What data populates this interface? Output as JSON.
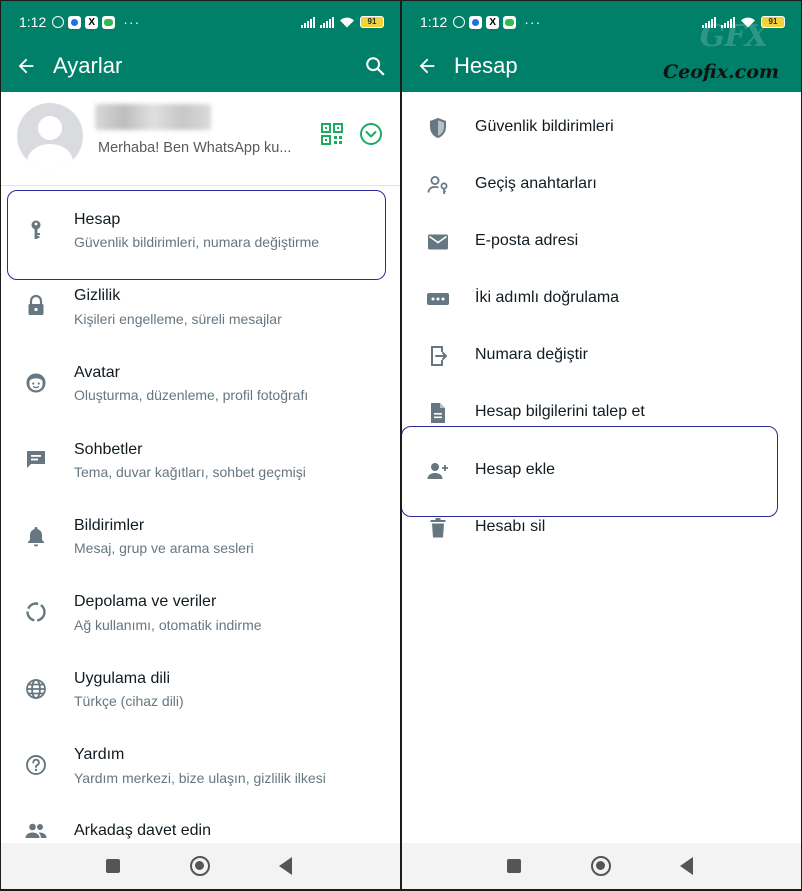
{
  "status_bar": {
    "time": "1:12",
    "battery": "91",
    "more": "···"
  },
  "left": {
    "title": "Ayarlar",
    "profile": {
      "status_text": "Merhaba! Ben WhatsApp ku..."
    },
    "items": [
      {
        "title": "Hesap",
        "subtitle": "Güvenlik bildirimleri, numara değiştirme",
        "icon": "key-icon"
      },
      {
        "title": "Gizlilik",
        "subtitle": "Kişileri engelleme, süreli mesajlar",
        "icon": "lock-icon"
      },
      {
        "title": "Avatar",
        "subtitle": "Oluşturma, düzenleme, profil fotoğrafı",
        "icon": "avatar-icon"
      },
      {
        "title": "Sohbetler",
        "subtitle": "Tema, duvar kağıtları, sohbet geçmişi",
        "icon": "chat-icon"
      },
      {
        "title": "Bildirimler",
        "subtitle": "Mesaj, grup ve arama sesleri",
        "icon": "bell-icon"
      },
      {
        "title": "Depolama ve veriler",
        "subtitle": "Ağ kullanımı, otomatik indirme",
        "icon": "storage-icon"
      },
      {
        "title": "Uygulama dili",
        "subtitle": "Türkçe (cihaz dili)",
        "icon": "globe-icon"
      },
      {
        "title": "Yardım",
        "subtitle": "Yardım merkezi, bize ulaşın, gizlilik ilkesi",
        "icon": "help-icon"
      },
      {
        "title": "Arkadaş davet edin",
        "subtitle": "",
        "icon": "people-icon"
      }
    ]
  },
  "right": {
    "title": "Hesap",
    "watermark": {
      "logo": "GFX",
      "brand": "Ceofix.com"
    },
    "items": [
      {
        "title": "Güvenlik bildirimleri",
        "icon": "shield-icon"
      },
      {
        "title": "Geçiş anahtarları",
        "icon": "passkey-icon"
      },
      {
        "title": "E-posta adresi",
        "icon": "email-icon"
      },
      {
        "title": "İki adımlı doğrulama",
        "icon": "dots-password-icon"
      },
      {
        "title": "Numara değiştir",
        "icon": "change-number-icon"
      },
      {
        "title": "Hesap bilgilerini talep et",
        "icon": "document-icon"
      },
      {
        "title": "Hesap ekle",
        "icon": "add-person-icon"
      },
      {
        "title": "Hesabı sil",
        "icon": "trash-icon"
      }
    ]
  },
  "colors": {
    "header": "#008069",
    "accent": "#1daa61",
    "icon_gray": "#667781",
    "highlight_border": "#2a2a9a"
  }
}
